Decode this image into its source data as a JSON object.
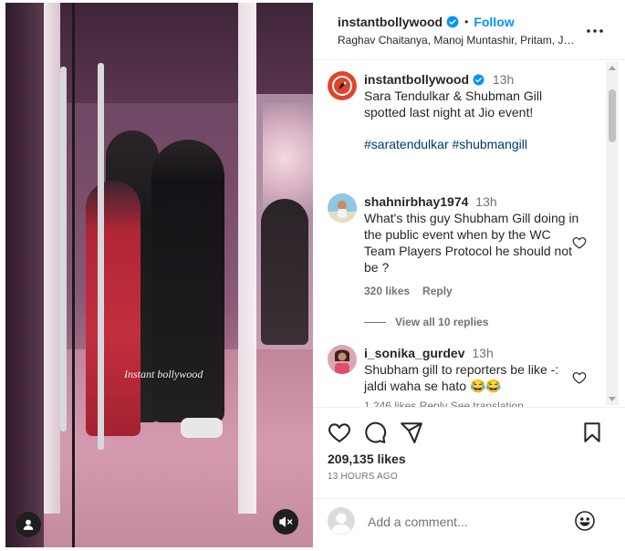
{
  "media": {
    "watermark": "Instant bollywood",
    "icons": {
      "user": "user-tag-icon",
      "mute": "muted-speaker-icon"
    }
  },
  "header": {
    "username": "instantbollywood",
    "separator": "•",
    "follow_label": "Follow",
    "subtitle": "Raghav Chaitanya, Manoj Muntashir, Pritam, JA...",
    "more_icon": "more-options-icon"
  },
  "caption": {
    "username": "instantbollywood",
    "time": "13h",
    "text": "Sara Tendulkar & Shubman Gill spotted last night at Jio event!",
    "hashtags": "#saratendulkar #shubmangill"
  },
  "comments": [
    {
      "username": "shahnirbhay1974",
      "time": "13h",
      "text": "What's this guy Shubham Gill doing in the public event when by the WC Team Players Protocol he should not be ?",
      "likes": "320 likes",
      "reply_label": "Reply",
      "view_replies": "View all 10 replies"
    },
    {
      "username": "i_sonika_gurdev",
      "time": "13h",
      "text": "Shubham gill to reporters be like -: jaldi waha se hato 😂😂",
      "partial_meta": "1,246 likes  Reply  See translation"
    }
  ],
  "actions": {
    "likes": "209,135 likes",
    "time_ago": "13 HOURS AGO"
  },
  "add_comment": {
    "placeholder": "Add a comment..."
  },
  "colors": {
    "accent": "#0095f6",
    "verified": "#0095f6",
    "hashtag": "#00376b",
    "secondary_text": "#737373"
  }
}
